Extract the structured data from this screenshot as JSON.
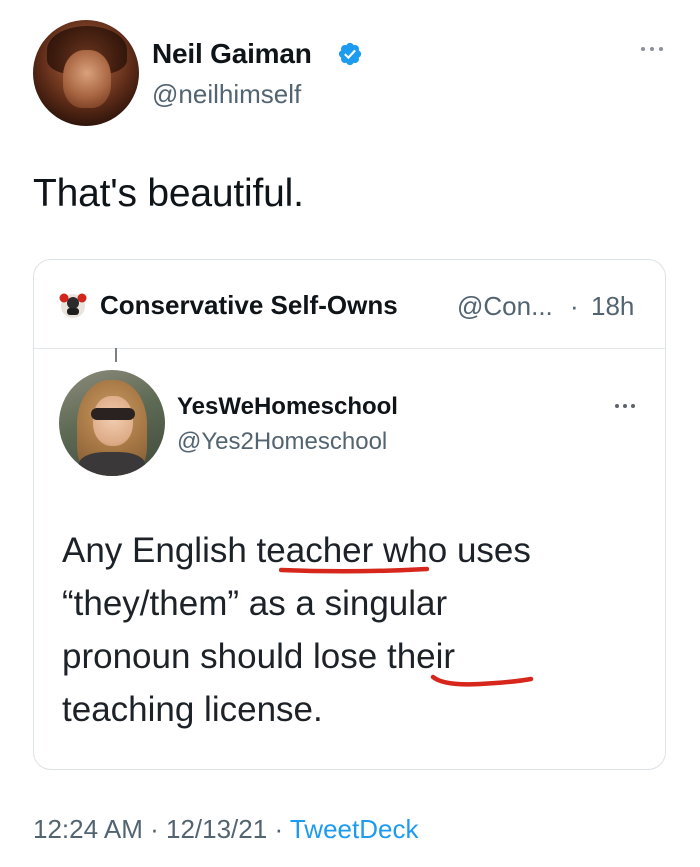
{
  "tweet": {
    "author": {
      "display_name": "Neil Gaiman",
      "handle": "@neilhimself",
      "verified": true
    },
    "text": "That's beautiful.",
    "timestamp": {
      "time": "12:24 AM",
      "date": "12/13/21",
      "source": "TweetDeck"
    }
  },
  "quoted_tweet": {
    "author_name": "Conservative Self-Owns",
    "author_handle": "@Con...",
    "separator": "·",
    "time_ago": "18h",
    "embedded_tweet": {
      "display_name": "YesWeHomeschool",
      "handle": "@Yes2Homeschool",
      "text_lines": [
        "Any English teacher who uses",
        "“they/them” as a singular",
        "pronoun should lose their",
        "teaching license."
      ]
    }
  },
  "colors": {
    "text_primary": "#0f1419",
    "text_secondary": "#536471",
    "link": "#1d9bf0",
    "verified": "#1d9bf0",
    "annotation_underline": "#d7261c",
    "border": "#dde2e6"
  },
  "icons": {
    "verified": "verified-badge-icon",
    "more": "more-options-icon"
  }
}
